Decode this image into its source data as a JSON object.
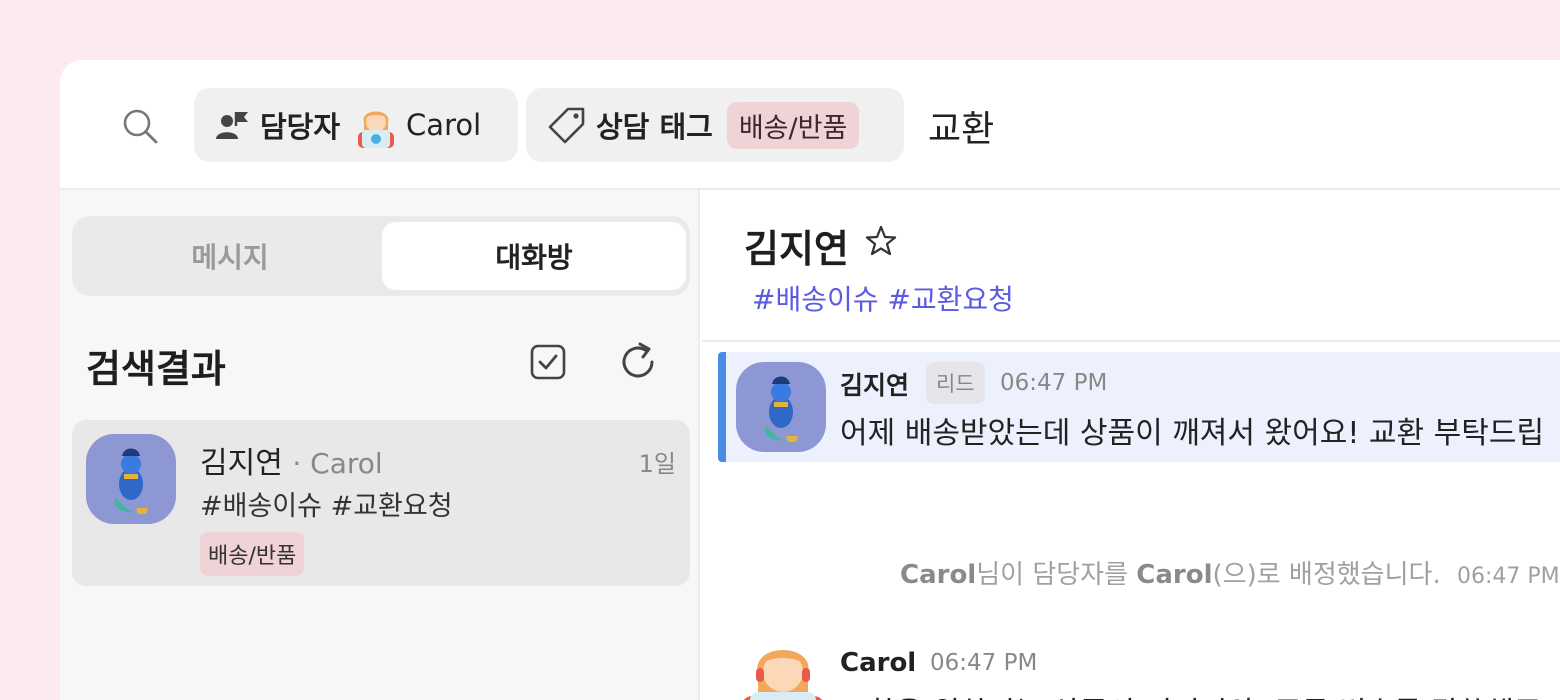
{
  "search": {
    "assignee_chip": {
      "label": "담당자",
      "value": "Carol"
    },
    "tag_chip": {
      "label": "상담 태그",
      "value": "배송/반품"
    },
    "query": "교환"
  },
  "left_panel": {
    "tabs": [
      {
        "label": "메시지",
        "active": false
      },
      {
        "label": "대화방",
        "active": true
      }
    ],
    "results_title": "검색결과",
    "results": [
      {
        "name": "김지연",
        "agent": "· Carol",
        "time": "1일",
        "tags": "#배송이슈 #교환요청",
        "tag_pill": "배송/반품"
      }
    ]
  },
  "chat": {
    "header": {
      "name": "김지연",
      "tags": "#배송이슈 #교환요청"
    },
    "messages": [
      {
        "sender": "김지연",
        "role": "리드",
        "time": "06:47 PM",
        "text": "어제 배송받았는데 상품이 깨져서 왔어요! 교환 부탁드립"
      },
      {
        "sender": "Carol",
        "time": "06:47 PM",
        "text": "교환을 원하시는 상품의 이미지와, 주문 번호를 말씀해주"
      }
    ],
    "system_message": {
      "actor": "Carol",
      "middle": "님이 담당자를",
      "target": "Carol",
      "suffix": "(으)로 배정했습니다.",
      "time": "06:47 PM"
    }
  },
  "colors": {
    "background": "#fdeaee",
    "accent_blue": "#4a8be8",
    "tag_text": "#5b5be0",
    "tag_pill": "#efd3d6",
    "avatar_bg": "#8d97d4"
  }
}
